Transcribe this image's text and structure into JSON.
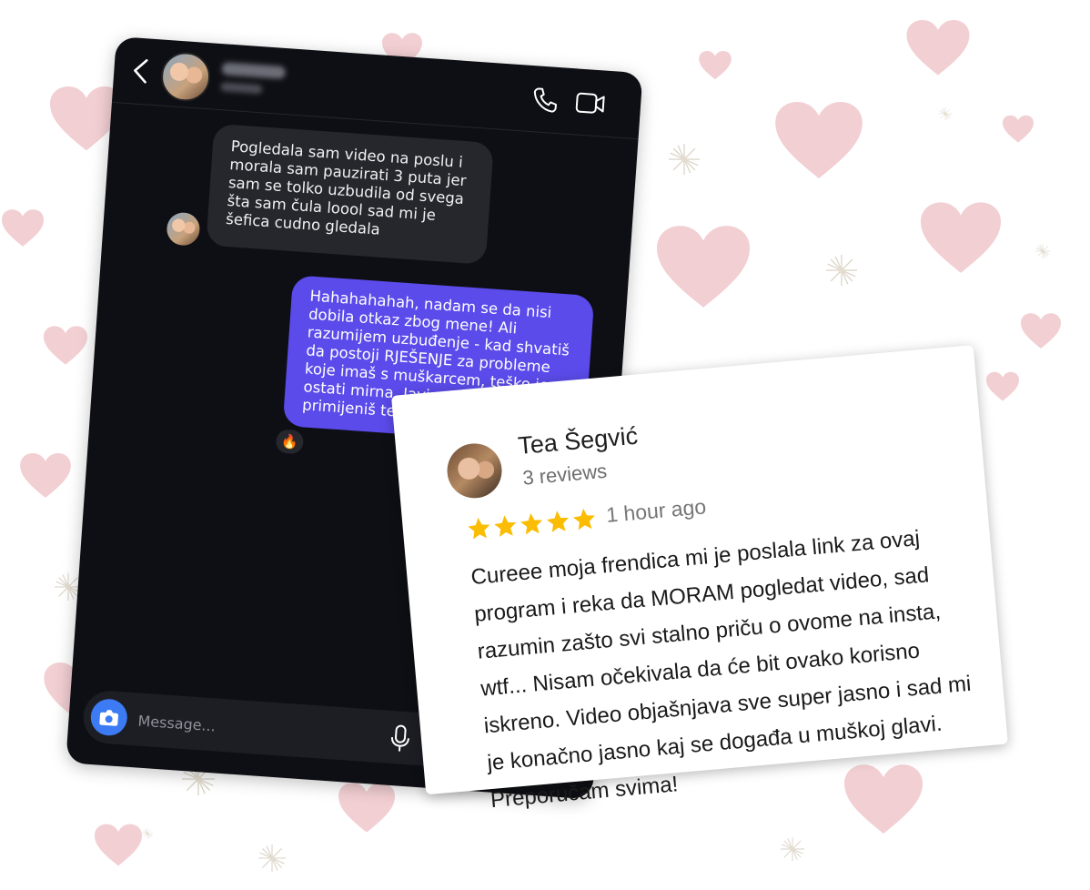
{
  "chat": {
    "back_icon": "chevron-left-icon",
    "call_icon": "phone-icon",
    "video_icon": "video-camera-icon",
    "incoming_message": "Pogledala sam video na poslu i morala sam pauzirati 3 puta jer sam se tolko uzbudila od svega šta sam čula loool sad mi je šefica cudno gledala",
    "outgoing_message": "Hahahahahah, nadam se da nisi dobila otkaz zbog mene! Ali razumijem uzbuđenje - kad shvatiš da postoji RJEŠENJE za probleme koje imaš s muškarcem, teško je ostati mirna. Javi mi kako ti primijeniš tehnike",
    "reaction": "🔥",
    "composer_placeholder": "Message...",
    "accent_color": "#5b4bea"
  },
  "review": {
    "name": "Tea Šegvić",
    "reviews_count": "3 reviews",
    "rating": 5,
    "time": "1 hour ago",
    "text": "Cureee moja frendica mi je poslala link za ovaj program i reka da MORAM pogledat video, sad razumin zašto svi stalno priču o ovome na insta, wtf... Nisam očekivala da će bit ovako korisno iskreno. Video objašnjava sve super jasno i sad mi je konačno jasno kaj se događa u muškoj glavi. Preporučam svima!",
    "star_color": "#fbbc04"
  }
}
